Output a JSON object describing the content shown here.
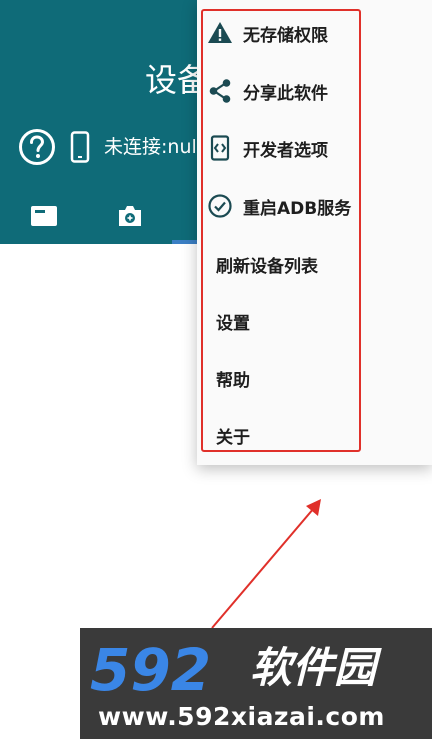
{
  "appbar": {
    "title": "设备",
    "status_text": "未连接:nul",
    "color": "#0f6b78",
    "tabs": [
      {
        "icon": "list-card-icon"
      },
      {
        "icon": "camera-icon"
      }
    ]
  },
  "menu": {
    "items": [
      {
        "label": "无存储权限",
        "icon": "warning-icon"
      },
      {
        "label": "分享此软件",
        "icon": "share-icon"
      },
      {
        "label": "开发者选项",
        "icon": "developer-code-icon"
      },
      {
        "label": "重启ADB服务",
        "icon": "check-circle-icon"
      },
      {
        "label": "刷新设备列表"
      },
      {
        "label": "设置"
      },
      {
        "label": "帮助"
      },
      {
        "label": "关于"
      }
    ],
    "highlight_color": "#e0302a"
  },
  "watermark": {
    "number": "592",
    "brand": "软件园",
    "url": "www.592xiazai.com"
  }
}
